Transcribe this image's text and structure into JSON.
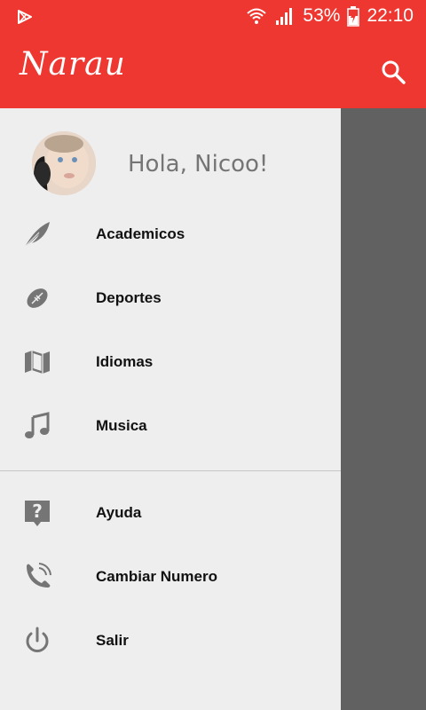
{
  "status_bar": {
    "battery": "53%",
    "time": "22:10"
  },
  "app_bar": {
    "title": "Narau"
  },
  "drawer": {
    "greeting": "Hola, Nicoo!",
    "primary_items": [
      {
        "label": "Academicos",
        "icon": "feather-icon"
      },
      {
        "label": "Deportes",
        "icon": "football-icon"
      },
      {
        "label": "Idiomas",
        "icon": "map-icon"
      },
      {
        "label": "Musica",
        "icon": "music-note-icon"
      }
    ],
    "secondary_items": [
      {
        "label": "Ayuda",
        "icon": "help-icon"
      },
      {
        "label": "Cambiar Numero",
        "icon": "phone-icon"
      },
      {
        "label": "Salir",
        "icon": "power-icon"
      }
    ]
  },
  "colors": {
    "primary": "#ee3731",
    "drawer_bg": "#eeeeee",
    "scrim": "#616161",
    "icon_gray": "#757575"
  }
}
